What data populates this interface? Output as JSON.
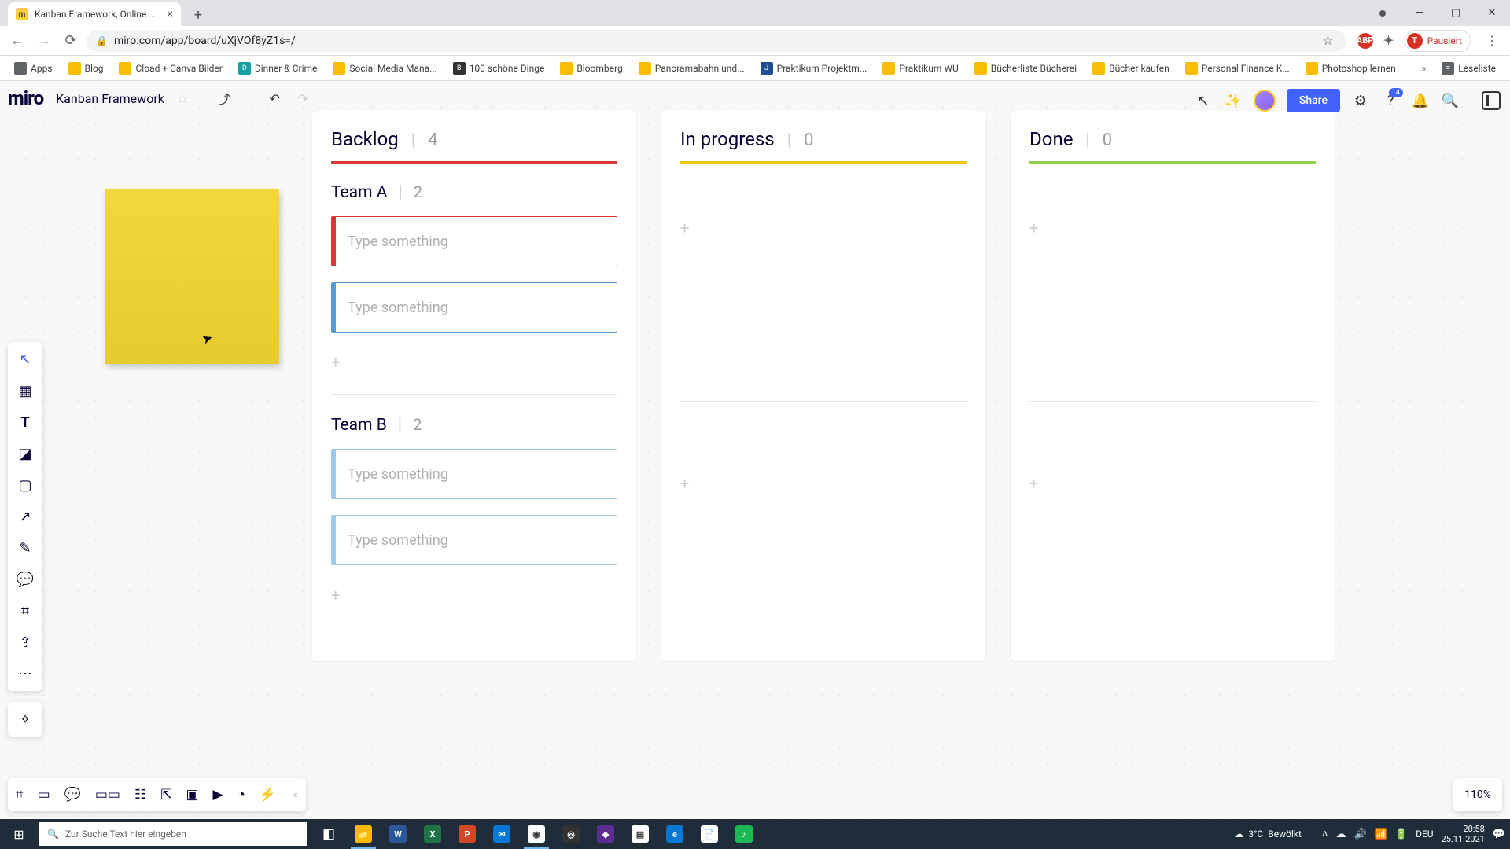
{
  "browser": {
    "tab_title": "Kanban Framework, Online Whit",
    "url": "miro.com/app/board/uXjVOf8yZ1s=/",
    "pausiert": "Pausiert",
    "bookmarks": [
      {
        "label": "Apps",
        "type": "folder"
      },
      {
        "label": "Blog"
      },
      {
        "label": "Cload + Canva Bilder"
      },
      {
        "label": "Dinner & Crime",
        "type": "teal"
      },
      {
        "label": "Social Media Mana..."
      },
      {
        "label": "100 schöne Dinge",
        "type": "dark"
      },
      {
        "label": "Bloomberg"
      },
      {
        "label": "Panoramabahn und..."
      },
      {
        "label": "Praktikum Projektm...",
        "type": "blue"
      },
      {
        "label": "Praktikum WU"
      },
      {
        "label": "Bücherliste Bücherei"
      },
      {
        "label": "Bücher kaufen"
      },
      {
        "label": "Personal Finance K..."
      },
      {
        "label": "Photoshop lernen"
      }
    ],
    "reading_list": "Leseliste"
  },
  "miro": {
    "logo": "miro",
    "board_name": "Kanban Framework",
    "share": "Share",
    "help_badge": "14",
    "zoom": "110%"
  },
  "kanban": {
    "columns": [
      {
        "title": "Backlog",
        "count": "4",
        "rule": "red"
      },
      {
        "title": "In progress",
        "count": "0",
        "rule": "yellow"
      },
      {
        "title": "Done",
        "count": "0",
        "rule": "green"
      }
    ],
    "teams": [
      {
        "name": "Team A",
        "count": "2",
        "cards": [
          {
            "placeholder": "Type something",
            "stripe": "red"
          },
          {
            "placeholder": "Type something",
            "stripe": "blue"
          }
        ]
      },
      {
        "name": "Team B",
        "count": "2",
        "cards": [
          {
            "placeholder": "Type something",
            "stripe": "lblue"
          },
          {
            "placeholder": "Type something",
            "stripe": "lblue"
          }
        ]
      }
    ]
  },
  "taskbar": {
    "search_placeholder": "Zur Suche Text hier eingeben",
    "weather_temp": "3°C",
    "weather_desc": "Bewölkt",
    "lang": "DEU",
    "time": "20:58",
    "date": "25.11.2021"
  }
}
